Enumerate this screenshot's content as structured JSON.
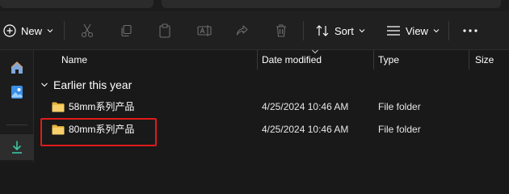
{
  "toolbar": {
    "new_label": "New",
    "sort_label": "Sort",
    "view_label": "View",
    "icons": [
      "plus-circle-icon",
      "cut-icon",
      "copy-icon",
      "paste-icon",
      "rename-icon",
      "share-icon",
      "delete-icon",
      "sort-icon",
      "view-icon",
      "more-icon"
    ]
  },
  "nav": {
    "items": [
      "home-icon",
      "gallery-icon",
      "downloads-icon"
    ]
  },
  "columns": {
    "name": "Name",
    "date_modified": "Date modified",
    "type": "Type",
    "size": "Size"
  },
  "group": {
    "label": "Earlier this year"
  },
  "rows": [
    {
      "name": "58mm系列产品",
      "date": "4/25/2024 10:46 AM",
      "type": "File folder"
    },
    {
      "name": "80mm系列产品",
      "date": "4/25/2024 10:46 AM",
      "type": "File folder"
    }
  ],
  "colors": {
    "highlight": "#e01b1b",
    "folder": "#f2c24f"
  }
}
